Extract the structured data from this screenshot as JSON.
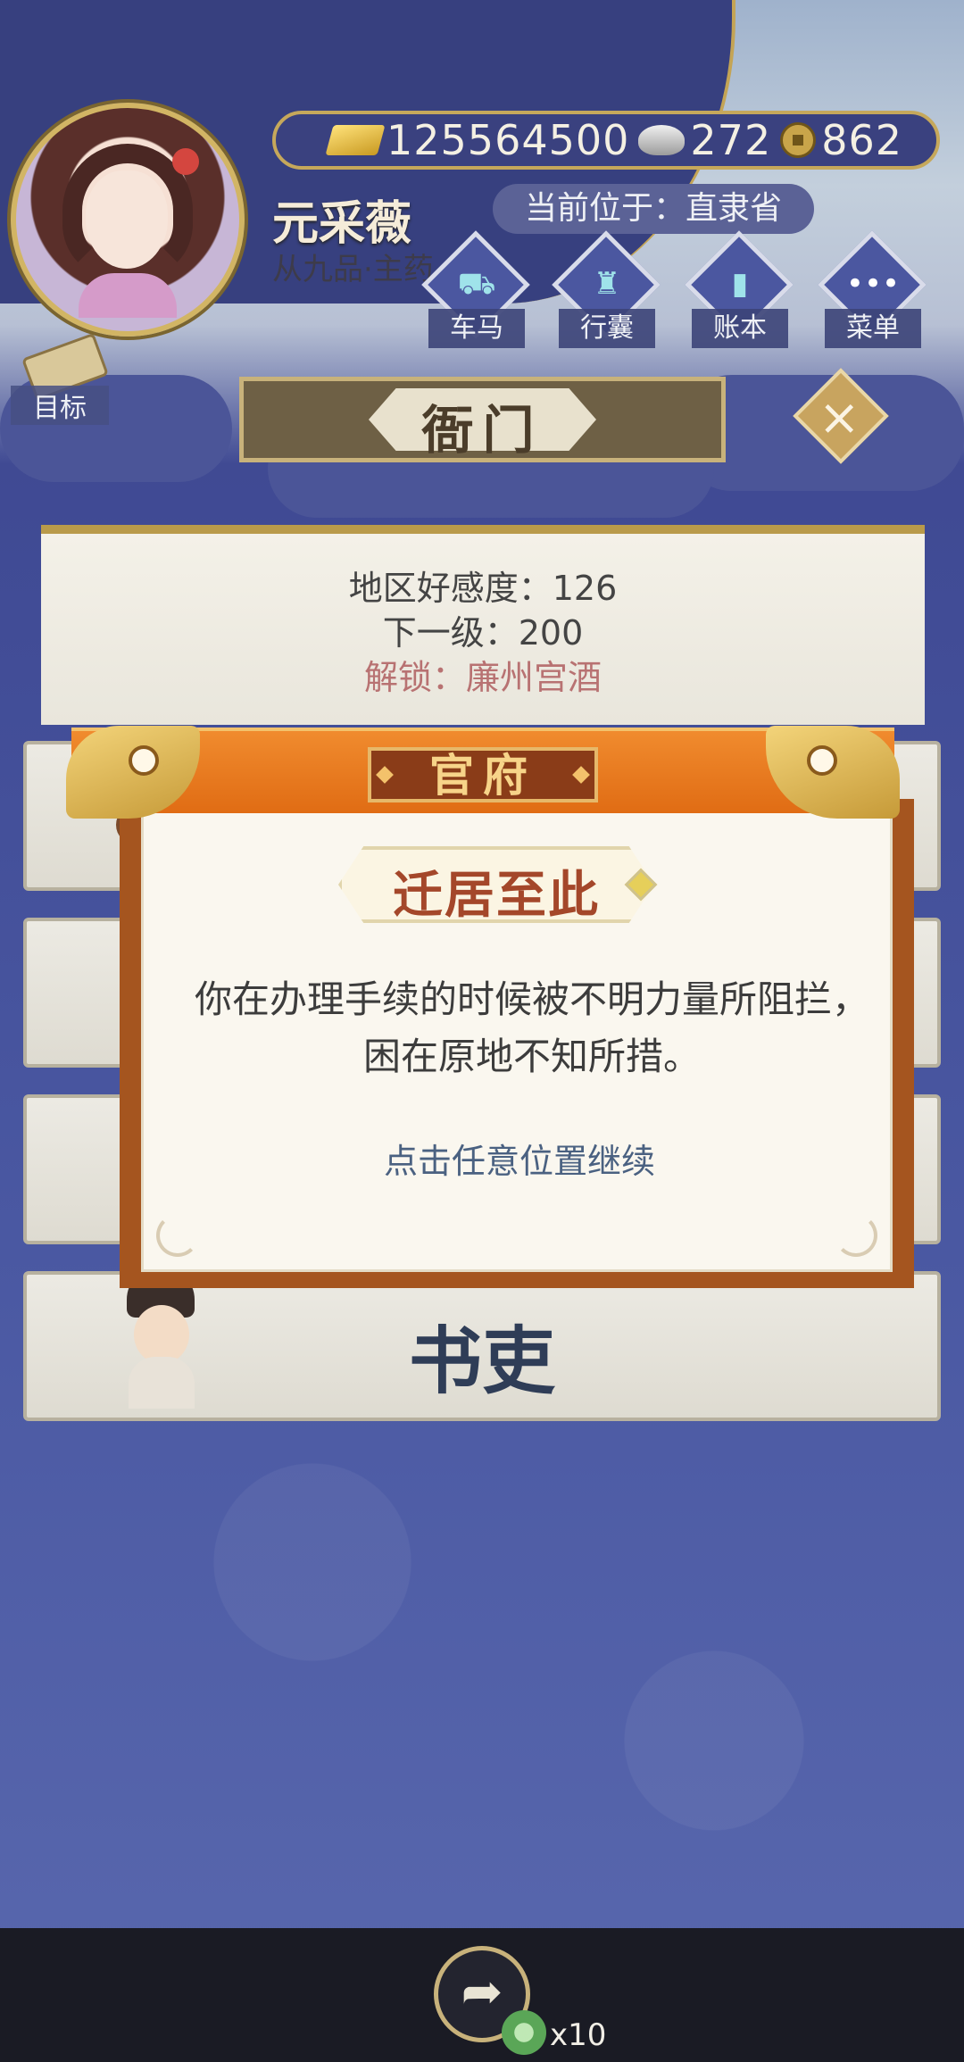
{
  "currency": {
    "gold": "125564500",
    "silver": "272",
    "copper": "862"
  },
  "player": {
    "name": "元采薇",
    "rank": "从九品·主药",
    "location": "当前位于：直隶省"
  },
  "menu": [
    {
      "label": "车马",
      "icon": "carriage-icon"
    },
    {
      "label": "行囊",
      "icon": "bag-icon"
    },
    {
      "label": "账本",
      "icon": "ledger-icon"
    },
    {
      "label": "菜单",
      "icon": "more-icon"
    }
  ],
  "goal_label": "目标",
  "screen_title": "衙门",
  "info": {
    "favor": "地区好感度：126",
    "next_level": "下一级：200",
    "unlock": "解锁：廉州宫酒"
  },
  "cards": {
    "clerk_label": "书吏"
  },
  "modal": {
    "header": "官府",
    "subtitle": "迁居至此",
    "message": "你在办理手续的时候被不明力量所阻拦，困在原地不知所措。",
    "hint": "点击任意位置继续"
  },
  "bottom": {
    "ticket_count": "x10"
  },
  "colors": {
    "background": "#414c96",
    "modal_header": "#e06c14",
    "modal_frame": "#a5551f",
    "subtitle_text": "#a4472a",
    "hint_text": "#4a6181"
  }
}
